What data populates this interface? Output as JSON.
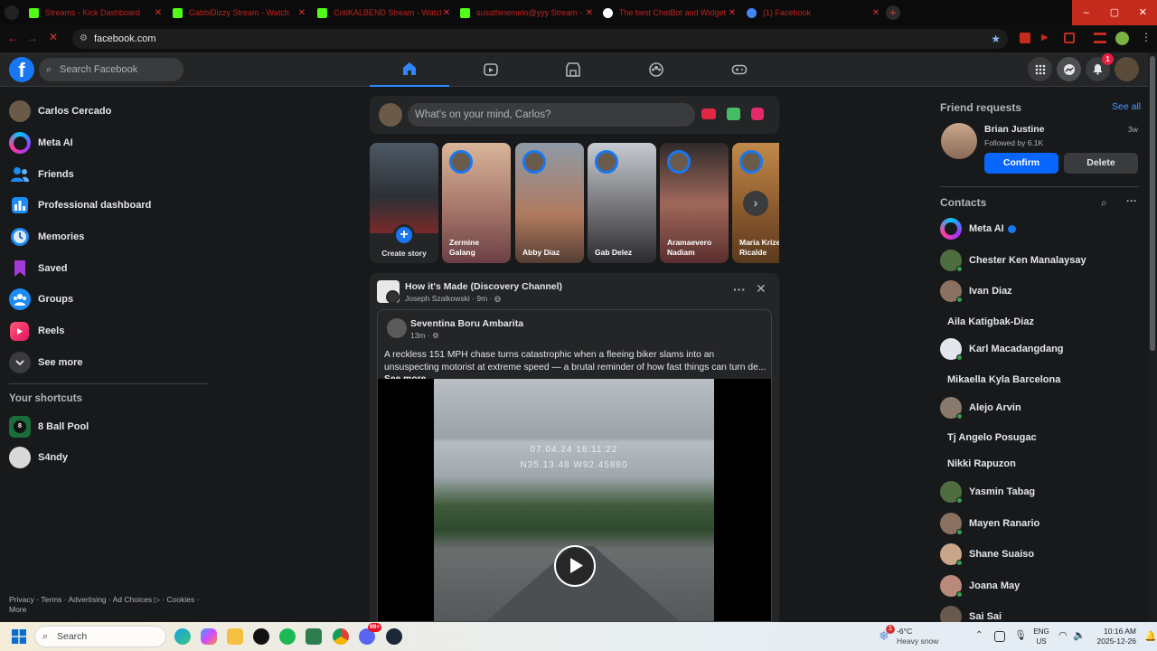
{
  "browser": {
    "tabs": [
      {
        "title": "Streams - Kick Dashboard",
        "icon": "kick-icon"
      },
      {
        "title": "GabbiDizzy Stream - Watch",
        "icon": "kick-icon"
      },
      {
        "title": "CritiKALBEND Stream - Watch Li",
        "icon": "kick-icon"
      },
      {
        "title": "sussthinemelo@yyy Stream - W",
        "icon": "kick-icon"
      },
      {
        "title": "The best ChatBot and Widget",
        "icon": "bot-icon"
      },
      {
        "title": "(1) Facebook",
        "icon": "facebook-icon"
      }
    ],
    "url": "facebook.com",
    "accent": "#c42b1c"
  },
  "header": {
    "logo": "f",
    "search_placeholder": "Search Facebook",
    "notification_count": "1"
  },
  "left_nav": {
    "items": [
      {
        "label": "Carlos Cercado",
        "icon": "profile-avatar"
      },
      {
        "label": "Meta AI",
        "icon": "meta-ai-icon"
      },
      {
        "label": "Friends",
        "icon": "friends-icon"
      },
      {
        "label": "Professional dashboard",
        "icon": "dashboard-icon"
      },
      {
        "label": "Memories",
        "icon": "clock-icon"
      },
      {
        "label": "Saved",
        "icon": "bookmark-icon"
      },
      {
        "label": "Groups",
        "icon": "groups-icon"
      },
      {
        "label": "Reels",
        "icon": "reels-icon"
      },
      {
        "label": "See more",
        "icon": "chevron-down-icon"
      }
    ],
    "shortcuts_title": "Your shortcuts",
    "shortcuts": [
      {
        "label": "8 Ball Pool"
      },
      {
        "label": "S4ndy"
      }
    ],
    "footer_line1": "Privacy · Terms · Advertising · Ad Choices ▷ · Cookies ·",
    "footer_line2": "More"
  },
  "composer": {
    "placeholder": "What's on your mind, Carlos?"
  },
  "stories": [
    {
      "name": "Create story",
      "type": "create"
    },
    {
      "name": "Zermine Galang"
    },
    {
      "name": "Abby Diaz"
    },
    {
      "name": "Gab Delez"
    },
    {
      "name": "Aramaevero Nadiam"
    },
    {
      "name": "Maria Krize Ricalde"
    }
  ],
  "post": {
    "page": "How it's Made (Discovery Channel)",
    "author": "Joseph Szalkowski",
    "time": "9m",
    "shared_author": "Seventina Boru Ambarita",
    "shared_time": "13m",
    "text": "A reckless 151 MPH chase turns catastrophic when a fleeing biker slams into an unsuspecting motorist at extreme speed — a brutal reminder of how fast things can turn de...",
    "see_more": "See more",
    "video_overlay_line1": "07.04.24 16:11:22",
    "video_overlay_line2": "N35.13.48 W92.45880"
  },
  "right_sidebar": {
    "friend_requests_title": "Friend requests",
    "see_all": "See all",
    "request": {
      "name": "Brian Justine",
      "mutual": "Followed by 6.1K",
      "time": "3w",
      "confirm": "Confirm",
      "delete": "Delete"
    },
    "contacts_title": "Contacts",
    "contacts": [
      {
        "name": "Meta AI",
        "avatar": "meta",
        "online": false,
        "verified": true
      },
      {
        "name": "Chester Ken Manalaysay",
        "avatar": true,
        "online": true
      },
      {
        "name": "Ivan Diaz",
        "avatar": true,
        "online": true
      },
      {
        "name": "Aila Katigbak-Diaz",
        "avatar": false,
        "online": false
      },
      {
        "name": "Karl Macadangdang",
        "avatar": "blank",
        "online": true
      },
      {
        "name": "Mikaella Kyla Barcelona",
        "avatar": false,
        "online": false
      },
      {
        "name": "Alejo Arvin",
        "avatar": true,
        "online": true
      },
      {
        "name": "Tj Angelo Posugac",
        "avatar": false,
        "online": false
      },
      {
        "name": "Nikki Rapuzon",
        "avatar": false,
        "online": false
      },
      {
        "name": "Yasmin Tabag",
        "avatar": true,
        "online": true
      },
      {
        "name": "Mayen Ranario",
        "avatar": true,
        "online": true
      },
      {
        "name": "Shane Suaiso",
        "avatar": true,
        "online": true
      },
      {
        "name": "Joana May",
        "avatar": true,
        "online": true
      },
      {
        "name": "Sai Sai",
        "avatar": true,
        "online": true
      }
    ]
  },
  "taskbar": {
    "search_placeholder": "Search",
    "weather_temp": "-6°C",
    "weather_desc": "Heavy snow",
    "weather_badge": "1",
    "lang_line1": "ENG",
    "lang_line2": "US",
    "time": "10:16 AM",
    "date": "2025-12-26",
    "discord_badge": "99+"
  }
}
